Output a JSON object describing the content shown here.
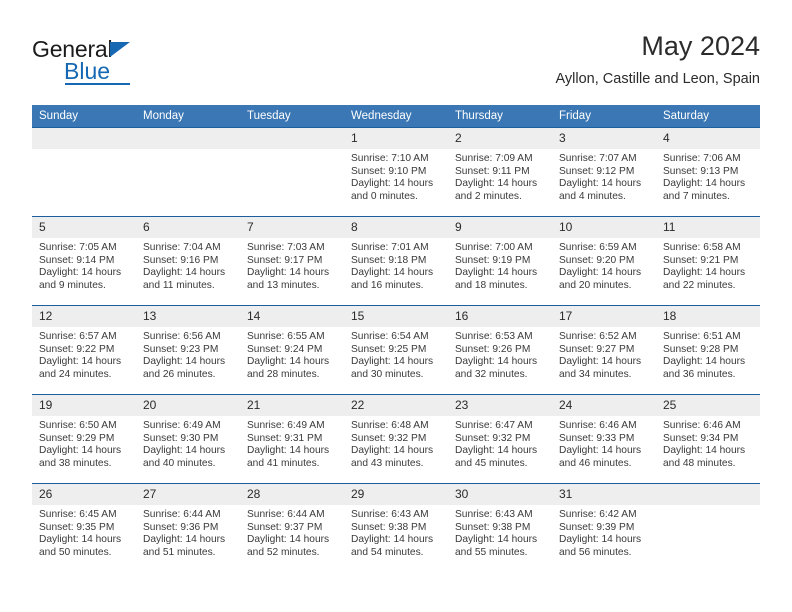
{
  "brand": {
    "name_top": "General",
    "name_bottom": "Blue",
    "accent_color": "#1668b3",
    "triangle_icon": "triangle-icon"
  },
  "header": {
    "title": "May 2024",
    "subtitle": "Ayllon, Castille and Leon, Spain"
  },
  "theme": {
    "header_row_bg": "#3a77b4",
    "row_border": "#1c5f9e",
    "date_band_bg": "#eeeeee",
    "text": "#3a3a3a"
  },
  "weekdays": [
    "Sunday",
    "Monday",
    "Tuesday",
    "Wednesday",
    "Thursday",
    "Friday",
    "Saturday"
  ],
  "weeks": [
    [
      {
        "day": "",
        "sunrise": "",
        "sunset": "",
        "daylight1": "",
        "daylight2": "",
        "empty": true
      },
      {
        "day": "",
        "sunrise": "",
        "sunset": "",
        "daylight1": "",
        "daylight2": "",
        "empty": true
      },
      {
        "day": "",
        "sunrise": "",
        "sunset": "",
        "daylight1": "",
        "daylight2": "",
        "empty": true
      },
      {
        "day": "1",
        "sunrise": "Sunrise: 7:10 AM",
        "sunset": "Sunset: 9:10 PM",
        "daylight1": "Daylight: 14 hours",
        "daylight2": "and 0 minutes."
      },
      {
        "day": "2",
        "sunrise": "Sunrise: 7:09 AM",
        "sunset": "Sunset: 9:11 PM",
        "daylight1": "Daylight: 14 hours",
        "daylight2": "and 2 minutes."
      },
      {
        "day": "3",
        "sunrise": "Sunrise: 7:07 AM",
        "sunset": "Sunset: 9:12 PM",
        "daylight1": "Daylight: 14 hours",
        "daylight2": "and 4 minutes."
      },
      {
        "day": "4",
        "sunrise": "Sunrise: 7:06 AM",
        "sunset": "Sunset: 9:13 PM",
        "daylight1": "Daylight: 14 hours",
        "daylight2": "and 7 minutes."
      }
    ],
    [
      {
        "day": "5",
        "sunrise": "Sunrise: 7:05 AM",
        "sunset": "Sunset: 9:14 PM",
        "daylight1": "Daylight: 14 hours",
        "daylight2": "and 9 minutes."
      },
      {
        "day": "6",
        "sunrise": "Sunrise: 7:04 AM",
        "sunset": "Sunset: 9:16 PM",
        "daylight1": "Daylight: 14 hours",
        "daylight2": "and 11 minutes."
      },
      {
        "day": "7",
        "sunrise": "Sunrise: 7:03 AM",
        "sunset": "Sunset: 9:17 PM",
        "daylight1": "Daylight: 14 hours",
        "daylight2": "and 13 minutes."
      },
      {
        "day": "8",
        "sunrise": "Sunrise: 7:01 AM",
        "sunset": "Sunset: 9:18 PM",
        "daylight1": "Daylight: 14 hours",
        "daylight2": "and 16 minutes."
      },
      {
        "day": "9",
        "sunrise": "Sunrise: 7:00 AM",
        "sunset": "Sunset: 9:19 PM",
        "daylight1": "Daylight: 14 hours",
        "daylight2": "and 18 minutes."
      },
      {
        "day": "10",
        "sunrise": "Sunrise: 6:59 AM",
        "sunset": "Sunset: 9:20 PM",
        "daylight1": "Daylight: 14 hours",
        "daylight2": "and 20 minutes."
      },
      {
        "day": "11",
        "sunrise": "Sunrise: 6:58 AM",
        "sunset": "Sunset: 9:21 PM",
        "daylight1": "Daylight: 14 hours",
        "daylight2": "and 22 minutes."
      }
    ],
    [
      {
        "day": "12",
        "sunrise": "Sunrise: 6:57 AM",
        "sunset": "Sunset: 9:22 PM",
        "daylight1": "Daylight: 14 hours",
        "daylight2": "and 24 minutes."
      },
      {
        "day": "13",
        "sunrise": "Sunrise: 6:56 AM",
        "sunset": "Sunset: 9:23 PM",
        "daylight1": "Daylight: 14 hours",
        "daylight2": "and 26 minutes."
      },
      {
        "day": "14",
        "sunrise": "Sunrise: 6:55 AM",
        "sunset": "Sunset: 9:24 PM",
        "daylight1": "Daylight: 14 hours",
        "daylight2": "and 28 minutes."
      },
      {
        "day": "15",
        "sunrise": "Sunrise: 6:54 AM",
        "sunset": "Sunset: 9:25 PM",
        "daylight1": "Daylight: 14 hours",
        "daylight2": "and 30 minutes."
      },
      {
        "day": "16",
        "sunrise": "Sunrise: 6:53 AM",
        "sunset": "Sunset: 9:26 PM",
        "daylight1": "Daylight: 14 hours",
        "daylight2": "and 32 minutes."
      },
      {
        "day": "17",
        "sunrise": "Sunrise: 6:52 AM",
        "sunset": "Sunset: 9:27 PM",
        "daylight1": "Daylight: 14 hours",
        "daylight2": "and 34 minutes."
      },
      {
        "day": "18",
        "sunrise": "Sunrise: 6:51 AM",
        "sunset": "Sunset: 9:28 PM",
        "daylight1": "Daylight: 14 hours",
        "daylight2": "and 36 minutes."
      }
    ],
    [
      {
        "day": "19",
        "sunrise": "Sunrise: 6:50 AM",
        "sunset": "Sunset: 9:29 PM",
        "daylight1": "Daylight: 14 hours",
        "daylight2": "and 38 minutes."
      },
      {
        "day": "20",
        "sunrise": "Sunrise: 6:49 AM",
        "sunset": "Sunset: 9:30 PM",
        "daylight1": "Daylight: 14 hours",
        "daylight2": "and 40 minutes."
      },
      {
        "day": "21",
        "sunrise": "Sunrise: 6:49 AM",
        "sunset": "Sunset: 9:31 PM",
        "daylight1": "Daylight: 14 hours",
        "daylight2": "and 41 minutes."
      },
      {
        "day": "22",
        "sunrise": "Sunrise: 6:48 AM",
        "sunset": "Sunset: 9:32 PM",
        "daylight1": "Daylight: 14 hours",
        "daylight2": "and 43 minutes."
      },
      {
        "day": "23",
        "sunrise": "Sunrise: 6:47 AM",
        "sunset": "Sunset: 9:32 PM",
        "daylight1": "Daylight: 14 hours",
        "daylight2": "and 45 minutes."
      },
      {
        "day": "24",
        "sunrise": "Sunrise: 6:46 AM",
        "sunset": "Sunset: 9:33 PM",
        "daylight1": "Daylight: 14 hours",
        "daylight2": "and 46 minutes."
      },
      {
        "day": "25",
        "sunrise": "Sunrise: 6:46 AM",
        "sunset": "Sunset: 9:34 PM",
        "daylight1": "Daylight: 14 hours",
        "daylight2": "and 48 minutes."
      }
    ],
    [
      {
        "day": "26",
        "sunrise": "Sunrise: 6:45 AM",
        "sunset": "Sunset: 9:35 PM",
        "daylight1": "Daylight: 14 hours",
        "daylight2": "and 50 minutes."
      },
      {
        "day": "27",
        "sunrise": "Sunrise: 6:44 AM",
        "sunset": "Sunset: 9:36 PM",
        "daylight1": "Daylight: 14 hours",
        "daylight2": "and 51 minutes."
      },
      {
        "day": "28",
        "sunrise": "Sunrise: 6:44 AM",
        "sunset": "Sunset: 9:37 PM",
        "daylight1": "Daylight: 14 hours",
        "daylight2": "and 52 minutes."
      },
      {
        "day": "29",
        "sunrise": "Sunrise: 6:43 AM",
        "sunset": "Sunset: 9:38 PM",
        "daylight1": "Daylight: 14 hours",
        "daylight2": "and 54 minutes."
      },
      {
        "day": "30",
        "sunrise": "Sunrise: 6:43 AM",
        "sunset": "Sunset: 9:38 PM",
        "daylight1": "Daylight: 14 hours",
        "daylight2": "and 55 minutes."
      },
      {
        "day": "31",
        "sunrise": "Sunrise: 6:42 AM",
        "sunset": "Sunset: 9:39 PM",
        "daylight1": "Daylight: 14 hours",
        "daylight2": "and 56 minutes."
      },
      {
        "day": "",
        "sunrise": "",
        "sunset": "",
        "daylight1": "",
        "daylight2": "",
        "empty": true
      }
    ]
  ]
}
